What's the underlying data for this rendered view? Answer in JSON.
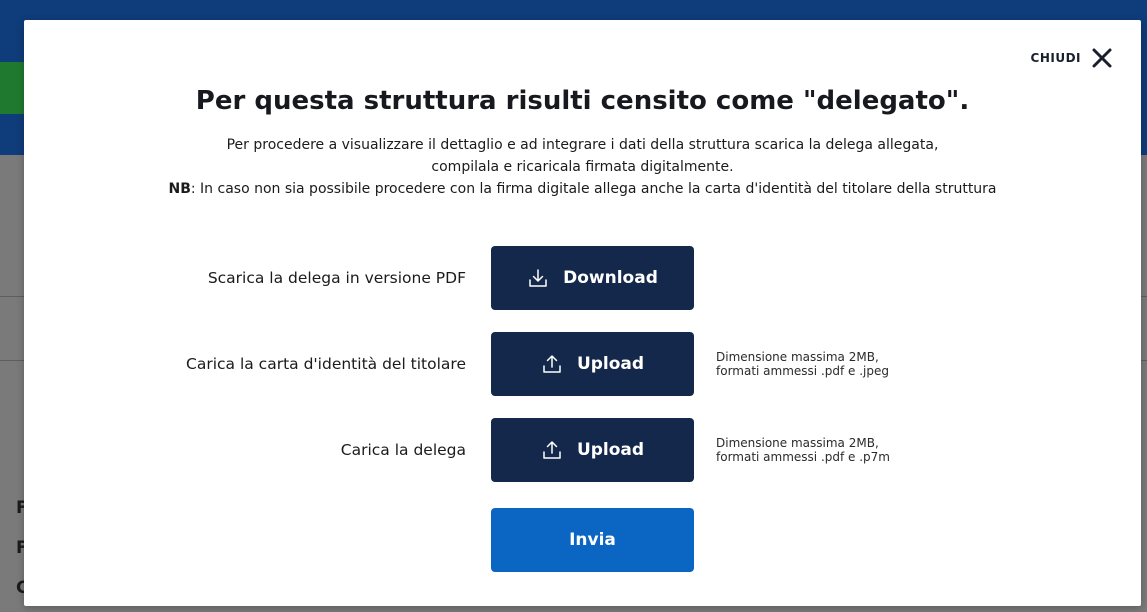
{
  "modal": {
    "close_label": "CHIUDI",
    "title": "Per questa struttura risulti censito come \"delegato\".",
    "intro_line1": "Per procedere a visualizzare il dettaglio e ad integrare i dati della struttura scarica la delega allegata,",
    "intro_line2": "compilala e ricaricala firmata digitalmente.",
    "nb_prefix": "NB",
    "nb_text": ": In caso non sia possibile procedere con la firma digitale allega anche la carta d'identità del titolare della struttura",
    "rows": [
      {
        "label": "Scarica la delega in versione PDF",
        "button_label": "Download",
        "button_icon": "download-icon"
      },
      {
        "label": "Carica la carta d'identità del titolare",
        "button_label": "Upload",
        "button_icon": "upload-icon",
        "note_line1": "Dimensione massima 2MB,",
        "note_line2": "formati ammessi .pdf e .jpeg"
      },
      {
        "label": "Carica la delega",
        "button_label": "Upload",
        "button_icon": "upload-icon",
        "note_line1": "Dimensione massima 2MB,",
        "note_line2": "formati ammessi .pdf e .p7m"
      }
    ],
    "submit_label": "Invia"
  },
  "background": {
    "letters": [
      "F",
      "F",
      "C"
    ]
  },
  "colors": {
    "primary_dark": "#14284b",
    "primary_blue": "#0a66c2",
    "overlay": "#7a7a7a"
  }
}
